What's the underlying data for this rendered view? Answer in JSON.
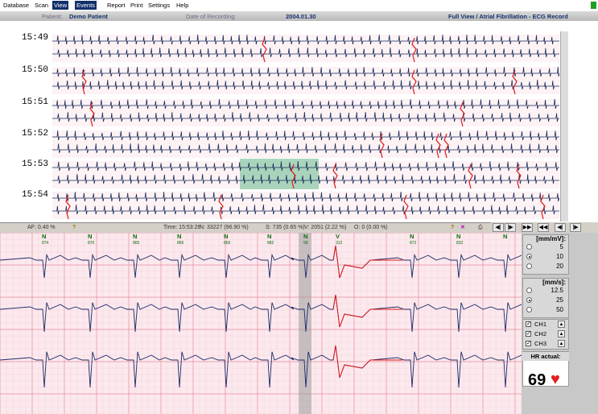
{
  "menu": [
    "Database",
    "Scan",
    "View",
    "Events",
    "Report",
    "Print",
    "Settings",
    "Help"
  ],
  "menu_active": [
    "View",
    "Events"
  ],
  "info": {
    "patient_label": "Patient:",
    "patient_name": "Demo Patient",
    "date_label": "Date of Recording:",
    "date_value": "2004.01.30",
    "view_title": "Full View / Atrial Fibrillation - ECG Record"
  },
  "overview": {
    "times": [
      "15:49",
      "15:50",
      "15:51",
      "15:52",
      "15:53",
      "15:54"
    ]
  },
  "toolbar": {
    "af_label": "AF: 0.40 %",
    "time": "Time: 15:53:26",
    "n_count": "N: 33227 (96.90 %)",
    "s_count": "S: 735 (0.65 %)",
    "v_count": "V: 2051 (2.22 %)",
    "o_count": "O: 0 (0.00 %)"
  },
  "nav_buttons": [
    "◀|",
    "|▶",
    "▶▶",
    "◀◀",
    "◀|",
    "|▶"
  ],
  "beats": [
    {
      "label": "N",
      "sub": "874"
    },
    {
      "label": "N",
      "sub": "870"
    },
    {
      "label": "N",
      "sub": "865"
    },
    {
      "label": "N",
      "sub": "866"
    },
    {
      "label": "N",
      "sub": "866"
    },
    {
      "label": "N",
      "sub": "882"
    },
    {
      "label": "N",
      "sub": "58"
    },
    {
      "label": "V",
      "sub": "312"
    },
    {
      "label": "N",
      "sub": "872"
    },
    {
      "label": "N",
      "sub": "832"
    },
    {
      "label": "N",
      "sub": ""
    }
  ],
  "gain": {
    "title": "[mm/mV]:",
    "options": [
      "5",
      "10",
      "20"
    ],
    "selected": "10"
  },
  "speed": {
    "title": "[mm/s]:",
    "options": [
      "12.5",
      "25",
      "50"
    ],
    "selected": "25"
  },
  "channels": [
    "CH1",
    "CH2",
    "CH3"
  ],
  "hr": {
    "title": "HR actual:",
    "value": "69"
  }
}
